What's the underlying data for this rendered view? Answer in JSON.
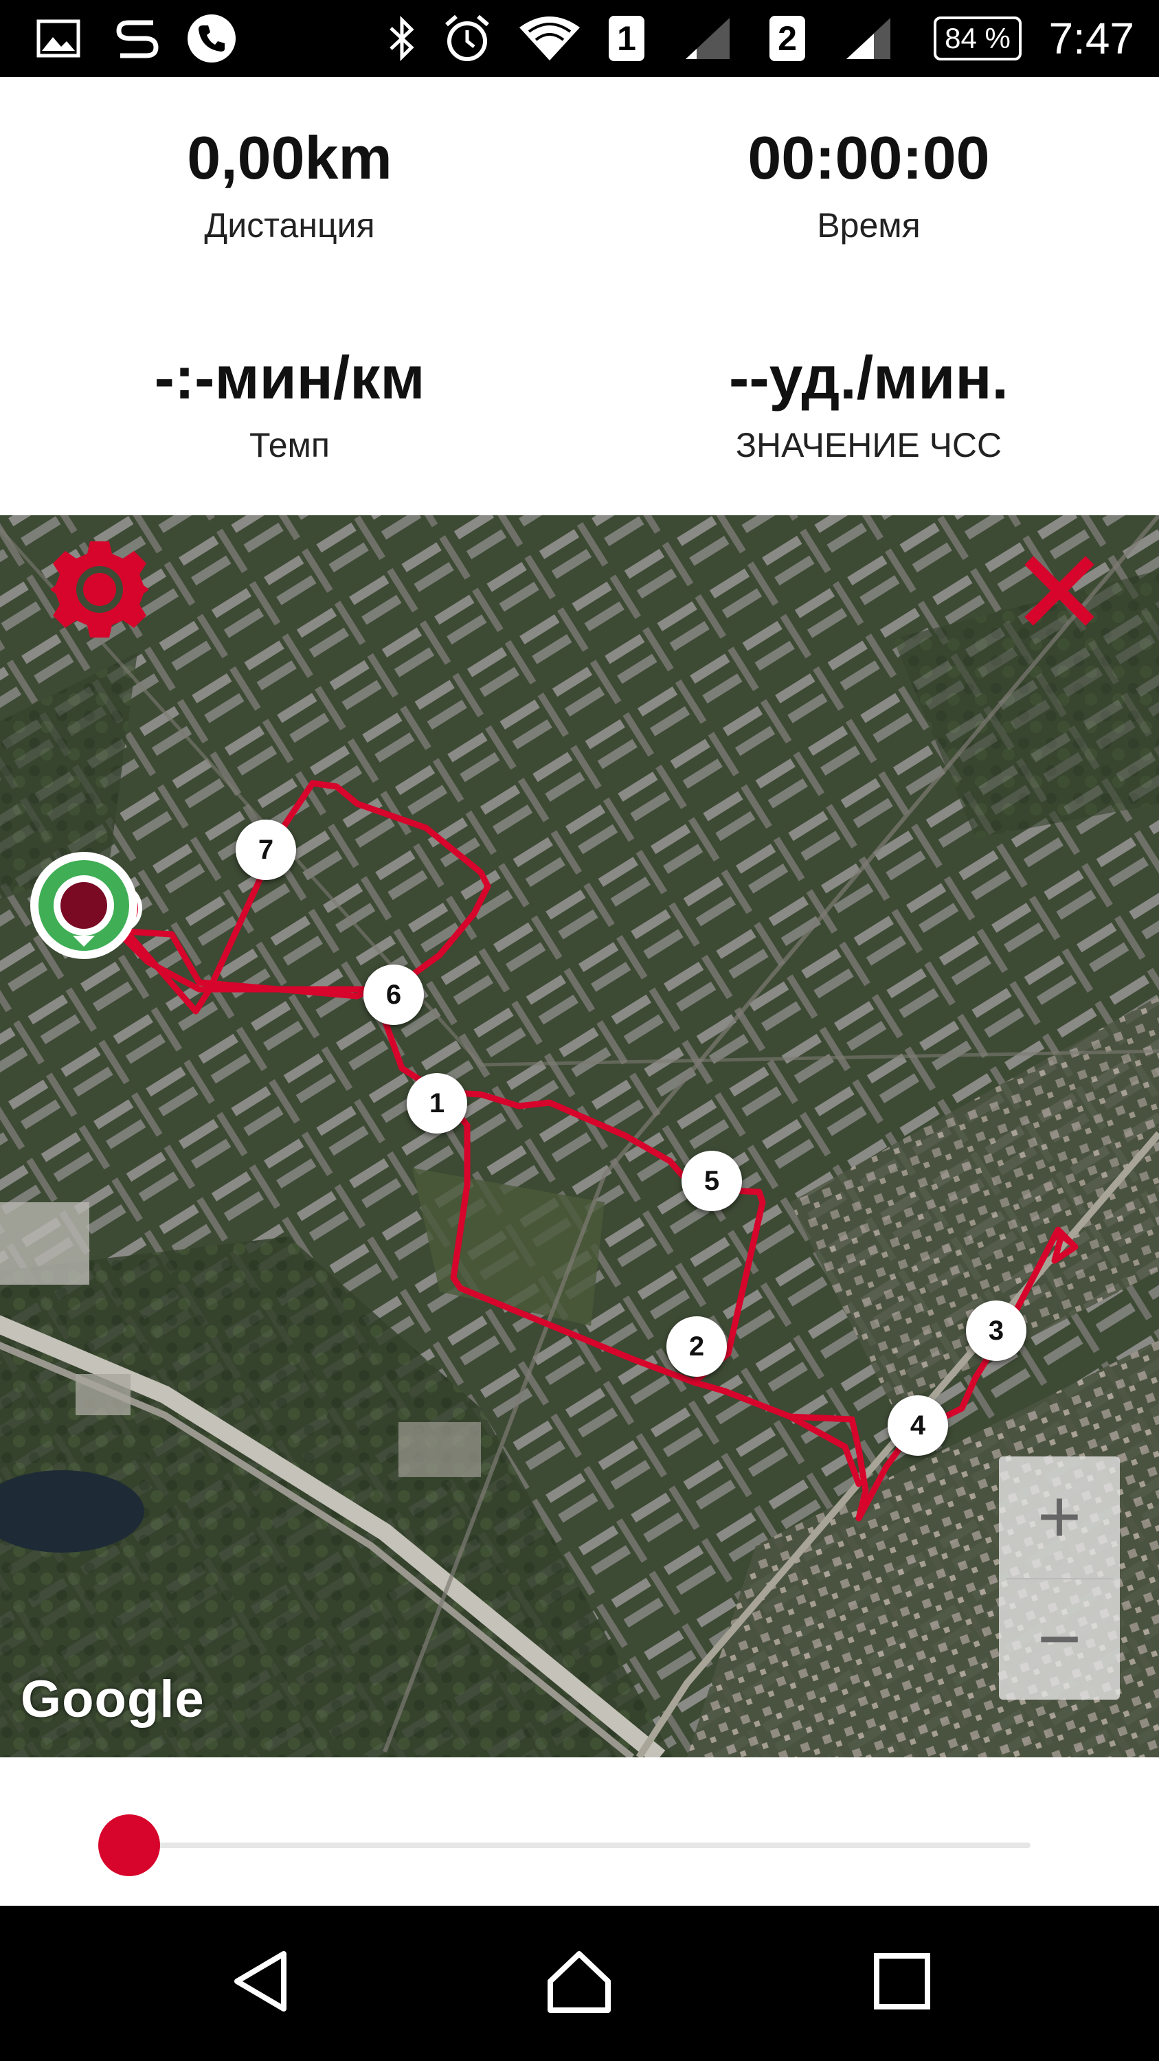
{
  "status_bar": {
    "time": "7:47",
    "battery": "84 %",
    "sim1": "1",
    "sim2": "2",
    "icons": [
      "gallery-icon",
      "s-app-icon",
      "phone-icon",
      "bluetooth-icon",
      "alarm-icon",
      "wifi-icon",
      "signal-icon",
      "signal-icon"
    ]
  },
  "stats": {
    "distance_value": "0,00km",
    "distance_label": "Дистанция",
    "time_value": "00:00:00",
    "time_label": "Время",
    "pace_value": "-:-мин/км",
    "pace_label": "Темп",
    "hr_value": "--уд./мин.",
    "hr_label": "ЗНАЧЕНИЕ ЧСС"
  },
  "map": {
    "attribution": "Google",
    "route_color": "#d7042b",
    "markers": [
      "1",
      "2",
      "3",
      "4",
      "5",
      "6",
      "7"
    ],
    "zoom_in": "+",
    "zoom_out": "−",
    "settings_icon": "gear-icon",
    "close_icon": "close-icon"
  },
  "slider": {
    "position": 0,
    "thumb_color": "#d7042b"
  },
  "nav": {
    "icons": [
      "back-icon",
      "home-icon",
      "recents-icon"
    ]
  }
}
